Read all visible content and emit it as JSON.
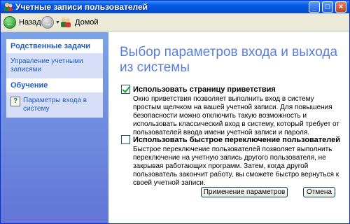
{
  "window": {
    "title": "Учетные записи пользователей"
  },
  "toolbar": {
    "back_label": "Назад",
    "home_label": "Домой"
  },
  "sidebar": {
    "related_tasks": {
      "title": "Родственные задачи",
      "items": [
        {
          "label": "Управление учетными записями"
        }
      ]
    },
    "learning": {
      "title": "Обучение",
      "items": [
        {
          "label": "Параметры входа в систему",
          "icon": "help-icon"
        }
      ]
    }
  },
  "main": {
    "heading": "Выбор параметров входа и выхода из системы",
    "options": [
      {
        "label": "Использовать страницу приветствия",
        "checked": true,
        "description": "Окно приветствия позволяет выполнить вход в систему простым щелчком на вашей учетной записи. Для повышения безопасности можно отключить такую возможность и использовать классический вход в систему, который требует от пользователей ввода имени учетной записи и пароля."
      },
      {
        "label": "Использовать быстрое переключение пользователей",
        "checked": false,
        "description": "Быстрое переключение пользователей позволяет выполнить переключение на учетную запись другого пользователя, не закрывая работающих программ. Затем, когда другой пользователь закончит работу, вы сможете быстро вернуться к своей учетной записи."
      }
    ],
    "apply_label": "Применение параметров",
    "cancel_label": "Отмена"
  },
  "colors": {
    "titlebar": "#0a5fe6",
    "sidebar": "#6375d6",
    "heading": "#5a7edc",
    "link": "#215dc6"
  }
}
